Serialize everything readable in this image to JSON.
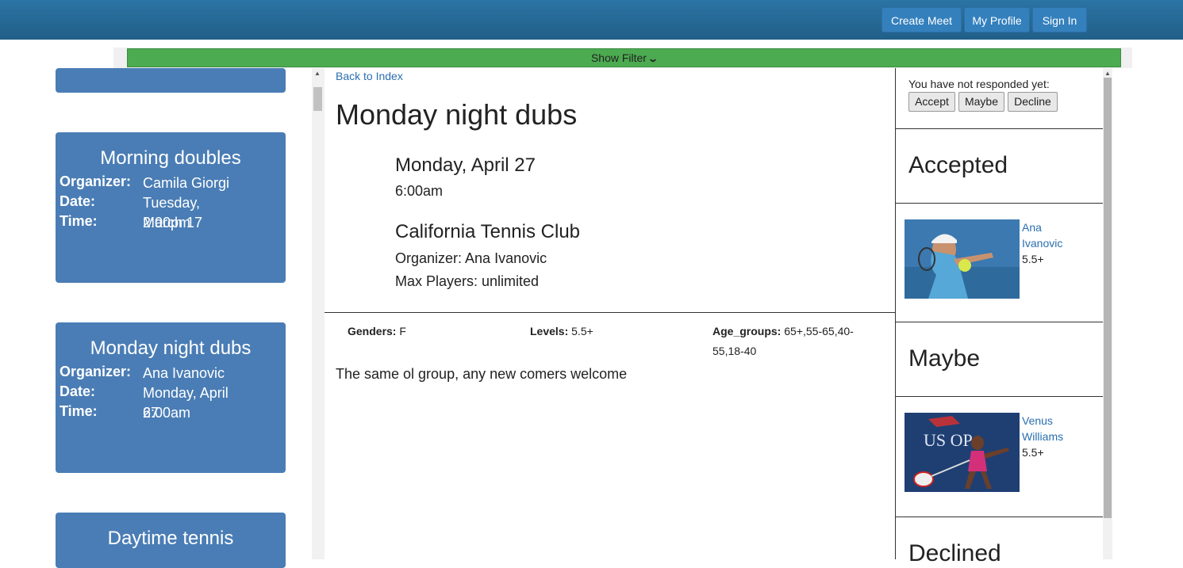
{
  "nav": {
    "create_meet": "Create Meet",
    "my_profile": "My Profile",
    "sign_in": "Sign In"
  },
  "filter": {
    "label": "Show Filter",
    "icon": "chevron-down-icon"
  },
  "cards": [
    {
      "title": "Morning doubles",
      "organizer_label": "Organizer:",
      "organizer": "Camila Giorgi",
      "date_label": "Date:",
      "date_line1": "Tuesday,",
      "date_line2": "March 17",
      "time_label": "Time:",
      "time": "2:00pm"
    },
    {
      "title": "Monday night dubs",
      "organizer_label": "Organizer:",
      "organizer": "Ana Ivanovic",
      "date_label": "Date:",
      "date_line1": "Monday, April",
      "date_line2": "27",
      "time_label": "Time:",
      "time": "6:00am"
    },
    {
      "title": "Daytime tennis"
    }
  ],
  "meet": {
    "back_link": "Back to Index",
    "title": "Monday night dubs",
    "date": "Monday, April 27",
    "time": "6:00am",
    "location": "California Tennis Club",
    "organizer": "Organizer: Ana Ivanovic",
    "max_players": "Max Players: unlimited",
    "genders_label": "Genders:",
    "genders": "F",
    "levels_label": "Levels:",
    "levels": "5.5+",
    "age_groups_label": "Age_groups:",
    "age_groups": "65+,55-65,40-55,18-40",
    "description": "The same ol group, any new comers welcome"
  },
  "response": {
    "note": "You have not responded yet:",
    "accept": "Accept",
    "maybe": "Maybe",
    "decline": "Decline",
    "accepted_title": "Accepted",
    "maybe_title": "Maybe",
    "declined_title": "Declined",
    "accepted_players": [
      {
        "name_line1": "Ana",
        "name_line2": "Ivanovic",
        "level": "5.5+"
      }
    ],
    "maybe_players": [
      {
        "name_line1": "Venus",
        "name_line2": "Williams",
        "level": "5.5+"
      }
    ]
  },
  "colors": {
    "navbar": "#2b74a4",
    "filter_bar": "#4cab50",
    "card": "#4a7db5",
    "link": "#2a6fb0"
  }
}
